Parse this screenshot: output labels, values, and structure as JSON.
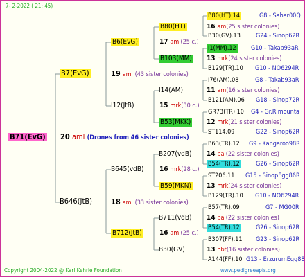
{
  "header": {
    "date": "7-  2-2022  ( 21: 45)"
  },
  "footer": {
    "copyright": "Copyright 2004-2022 @ Karl Kehrle Foundation",
    "site": "www.pedigreeapis.org"
  },
  "root": {
    "name": "B71(EvG)",
    "year": "20",
    "unit": "aml",
    "colonies": "(Drones from 46 sister colonies)"
  },
  "gen1": [
    {
      "name": "B7(EvG)",
      "year": "19",
      "unit": "aml",
      "colonies": "(43 sister colonies)"
    },
    {
      "name": "B646(JtB)",
      "year": "18",
      "unit": "aml",
      "colonies": "(33 sister colonies)"
    }
  ],
  "gen2": [
    {
      "name": "B6(EvG)",
      "year": "17",
      "unit": "aml",
      "colonies": "(25 c.)"
    },
    {
      "name": "I12(JtB)",
      "year": "15",
      "unit": "mrk",
      "colonies": "(30 c.)"
    },
    {
      "name": "B645(vdB)",
      "year": "16",
      "unit": "mrk",
      "colonies": "(28 c.)"
    },
    {
      "name": "B712(JtB)",
      "year": "16",
      "unit": "aml",
      "colonies": "(25 c.)"
    }
  ],
  "gen3": [
    {
      "name": "B80(HT)",
      "year": "16",
      "unit": "am",
      "colonies": "(25 sister colonies)",
      "top": "B80(HT).14",
      "top_code": "G8 - Sahar00Q",
      "bot": "B30(GV).13",
      "bot_code": "G24 - Sinop62R"
    },
    {
      "name": "B103(MM)",
      "year": "13",
      "unit": "mrk",
      "colonies": "(24 sister colonies)",
      "top": "I1(MM).12",
      "top_code": "G10 - Takab93aR",
      "bot": "B129(TR).10",
      "bot_code": "G10 - NO6294R"
    },
    {
      "name": "I14(AM)",
      "year": "11",
      "unit": "am",
      "colonies": "(16 sister colonies)",
      "top": "I76(AM).08",
      "top_code": "G8 - Takab93aR",
      "bot": "B121(AM).06",
      "bot_code": "G18 - Sinop72R"
    },
    {
      "name": "B53(MKK)",
      "year": "12",
      "unit": "mrk",
      "colonies": "(21 sister colonies)",
      "top": "GR73(TR).10",
      "top_code": "G4 - Gr.R.mounta",
      "bot": "ST114.09",
      "bot_code": "G22 - Sinop62R"
    },
    {
      "name": "B207(vdB)",
      "year": "14",
      "unit": "bal",
      "colonies": "(22 sister colonies)",
      "top": "B63(TR).12",
      "top_code": "G9 - Kangaroo98R",
      "bot": "B54(TR).12",
      "bot_code": "G26 - Sinop62R"
    },
    {
      "name": "B59(MKN)",
      "year": "13",
      "unit": "mrk",
      "colonies": "(24 sister colonies)",
      "top": "ST206.11",
      "top_code": "G15 - SinopEgg86R",
      "bot": "B129(TR).10",
      "bot_code": "G10 - NO6294R"
    },
    {
      "name": "B711(vdB)",
      "year": "14",
      "unit": "bal",
      "colonies": "(22 sister colonies)",
      "top": "B57(TR).09",
      "top_code": "G7 - MG00R",
      "bot": "B54(TR).12",
      "bot_code": "G26 - Sinop62R"
    },
    {
      "name": "B30(GV)",
      "year": "13",
      "unit": "hbt",
      "colonies": "(16 sister colonies)",
      "top": "B307(FF).11",
      "top_code": "G23 - Sinop62R",
      "bot": "A144(FF).10",
      "bot_code": "G13 - ErzurumEgg88"
    }
  ]
}
